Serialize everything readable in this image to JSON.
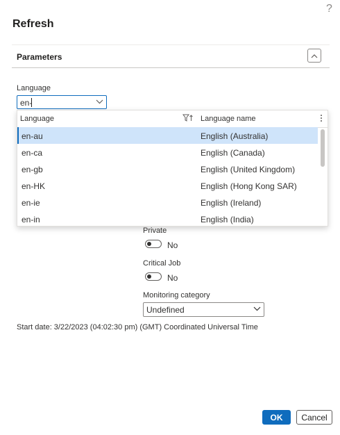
{
  "help_icon": "?",
  "dialog": {
    "title": "Refresh"
  },
  "parameters": {
    "title": "Parameters"
  },
  "language": {
    "label": "Language",
    "value": "en-",
    "dropdown": {
      "col1": "Language",
      "col2": "Language name",
      "rows": [
        {
          "code": "en-au",
          "name": "English (Australia)",
          "selected": true
        },
        {
          "code": "en-ca",
          "name": "English (Canada)"
        },
        {
          "code": "en-gb",
          "name": "English (United Kingdom)"
        },
        {
          "code": "en-HK",
          "name": "English (Hong Kong SAR)"
        },
        {
          "code": "en-ie",
          "name": "English (Ireland)"
        },
        {
          "code": "en-in",
          "name": "English (India)"
        }
      ]
    }
  },
  "private": {
    "label": "Private",
    "value": "No"
  },
  "critical_job": {
    "label": "Critical Job",
    "value": "No"
  },
  "monitoring_category": {
    "label": "Monitoring category",
    "value": "Undefined"
  },
  "start_date": "Start date: 3/22/2023 (04:02:30 pm) (GMT) Coordinated Universal Time",
  "buttons": {
    "ok": "OK",
    "cancel": "Cancel"
  },
  "colors": {
    "accent": "#0f6cbd",
    "selected_row": "#cfe4fa"
  }
}
